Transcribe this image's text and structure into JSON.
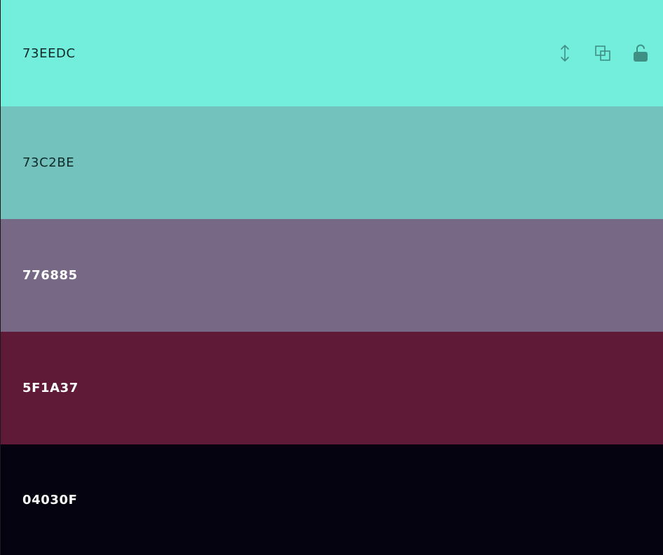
{
  "swatches": [
    {
      "hex": "73EEDC",
      "bg": "#73EEDC",
      "text_color": "#0d2a27",
      "tool_color": "#3f8f84"
    },
    {
      "hex": "73C2BE",
      "bg": "#73C2BE",
      "text_color": "#0d2a27"
    },
    {
      "hex": "776885",
      "bg": "#776885",
      "text_color": "#ffffff"
    },
    {
      "hex": "5F1A37",
      "bg": "#5F1A37",
      "text_color": "#ffffff"
    },
    {
      "hex": "04030F",
      "bg": "#04030F",
      "text_color": "#ffffff"
    }
  ],
  "tools": {
    "drag_icon": "vertical-arrows-icon",
    "copy_icon": "copy-icon",
    "lock_icon": "unlocked-padlock-icon"
  }
}
